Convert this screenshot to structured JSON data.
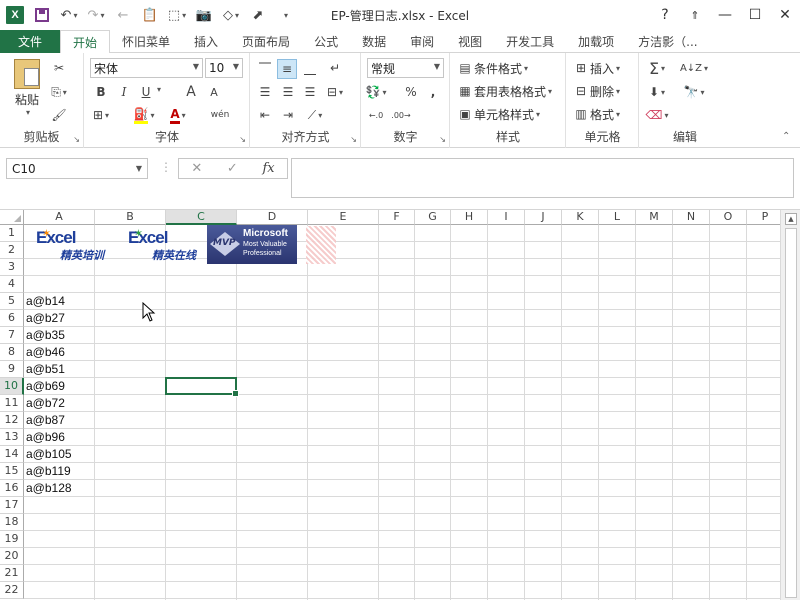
{
  "window": {
    "title": "EP-管理日志.xlsx - Excel",
    "help": "?",
    "controls": [
      "restore-ribbon",
      "minimize",
      "maximize",
      "close"
    ]
  },
  "qat": {
    "app_letter": "X"
  },
  "tabs": [
    {
      "label": "文件"
    },
    {
      "label": "开始"
    },
    {
      "label": "怀旧菜单"
    },
    {
      "label": "插入"
    },
    {
      "label": "页面布局"
    },
    {
      "label": "公式"
    },
    {
      "label": "数据"
    },
    {
      "label": "审阅"
    },
    {
      "label": "视图"
    },
    {
      "label": "开发工具"
    },
    {
      "label": "加载项"
    },
    {
      "label": "方洁影（..."
    }
  ],
  "ribbon": {
    "clipboard": {
      "label": "剪贴板",
      "paste": "粘贴"
    },
    "font": {
      "label": "字体",
      "font_name": "宋体",
      "font_size": "10",
      "bold": "B",
      "italic": "I",
      "underline": "U",
      "grow": "A",
      "shrink": "A",
      "phonetic": "wén"
    },
    "alignment": {
      "label": "对齐方式"
    },
    "number": {
      "label": "数字",
      "format": "常规",
      "percent": "%",
      "comma": ","
    },
    "styles": {
      "label": "样式",
      "conditional": "条件格式",
      "table": "套用表格格式",
      "cell_styles": "单元格样式"
    },
    "cells": {
      "label": "单元格",
      "insert": "插入",
      "delete": "删除",
      "format": "格式"
    },
    "editing": {
      "label": "编辑"
    }
  },
  "formula_bar": {
    "name_box": "C10",
    "fx": "fx",
    "value": ""
  },
  "grid": {
    "columns": [
      "A",
      "B",
      "C",
      "D",
      "E",
      "F",
      "G",
      "H",
      "I",
      "J",
      "K",
      "L",
      "M",
      "N",
      "O",
      "P"
    ],
    "rows": [
      "1",
      "2",
      "3",
      "4",
      "5",
      "6",
      "7",
      "8",
      "9",
      "10",
      "11",
      "12",
      "13",
      "14",
      "15",
      "16",
      "17",
      "18",
      "19",
      "20",
      "21",
      "22"
    ],
    "selected_cell": "C10",
    "cells": [
      {
        "ref": "A5",
        "value": "a@b14"
      },
      {
        "ref": "A6",
        "value": "a@b27"
      },
      {
        "ref": "A7",
        "value": "a@b35"
      },
      {
        "ref": "A8",
        "value": "a@b46"
      },
      {
        "ref": "A9",
        "value": "a@b51"
      },
      {
        "ref": "A10",
        "value": "a@b69"
      },
      {
        "ref": "A11",
        "value": "a@b72"
      },
      {
        "ref": "A12",
        "value": "a@b87"
      },
      {
        "ref": "A13",
        "value": "a@b96"
      },
      {
        "ref": "A14",
        "value": "a@b105"
      },
      {
        "ref": "A15",
        "value": "a@b119"
      },
      {
        "ref": "A16",
        "value": "a@b128"
      }
    ]
  },
  "logos": {
    "excel_training": {
      "word": "Excel",
      "sub": "精英培训"
    },
    "excel_online": {
      "word": "Excel",
      "sub": "精英在线"
    },
    "mvp": {
      "badge": "MVP",
      "line1": "Microsoft",
      "line2": "Most Valuable",
      "line3": "Professional"
    }
  },
  "colors": {
    "accent": "#217346",
    "selection_header": "#e1e1e1"
  }
}
